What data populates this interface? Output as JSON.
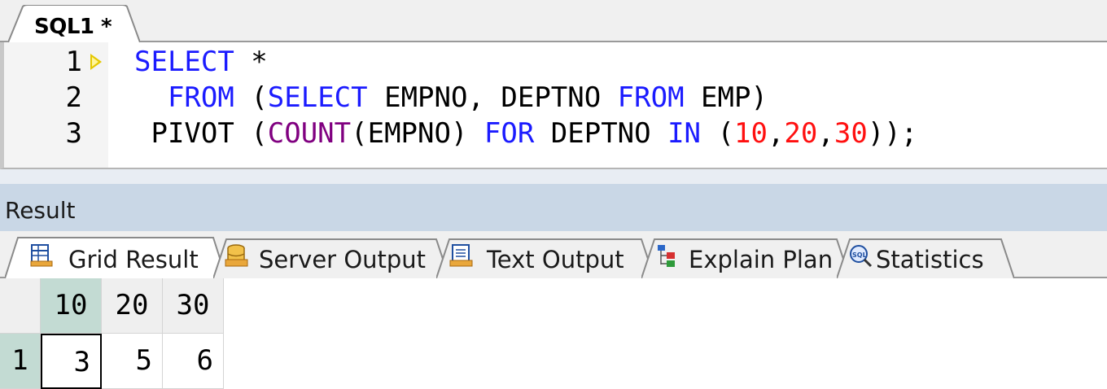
{
  "editor_tab": {
    "label": "SQL1 *"
  },
  "editor": {
    "lines": [
      {
        "number": "1",
        "executing": true
      },
      {
        "number": "2",
        "executing": false
      },
      {
        "number": "3",
        "executing": false
      }
    ]
  },
  "result": {
    "title": "Result",
    "tabs": [
      {
        "label": "Grid Result",
        "icon": "grid-icon",
        "active": true
      },
      {
        "label": "Server Output",
        "icon": "database-icon",
        "active": false
      },
      {
        "label": "Text Output",
        "icon": "text-document-icon",
        "active": false
      },
      {
        "label": "Explain Plan",
        "icon": "tree-plan-icon",
        "active": false
      },
      {
        "label": "Statistics",
        "icon": "sql-magnifier-icon",
        "active": false
      }
    ],
    "grid": {
      "columns": [
        "10",
        "20",
        "30"
      ],
      "rows": [
        {
          "row_number": "1",
          "values": [
            "3",
            "5",
            "6"
          ]
        }
      ]
    }
  },
  "colors": {
    "keyword": "#1b1bff",
    "function": "#800080",
    "number_literal": "#ff1010",
    "active_header": "#c3dbd3",
    "result_header_bg": "#c9d7e6"
  }
}
